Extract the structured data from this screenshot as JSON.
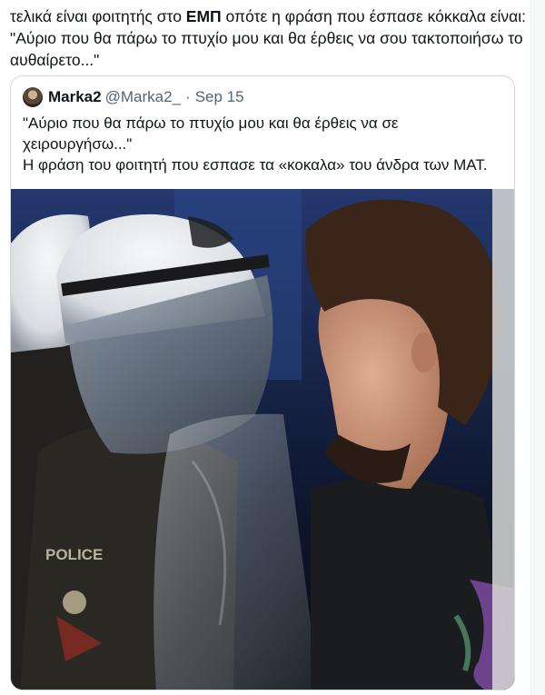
{
  "tweet": {
    "text_before": "τελικά είναι φοιτητής στο ",
    "text_bold": "ΕΜΠ",
    "text_after": " οπότε η φράση που έσπασε κόκκαλα είναι: \"Αύριο που θα πάρω το πτυχίο μου και θα έρθεις να σου τακτοποιήσω το αυθαίρετο...\""
  },
  "quoted": {
    "display_name": "Marka2",
    "handle": "@Marka2_",
    "separator": "·",
    "date": "Sep 15",
    "line1": "\"Αύριο που θα πάρω το πτυχίο μου και θα έρθεις να σε χειρουργήσω...\"",
    "line2": "Η φράση του φοιτητή που εσπασε τα «κοκαλα» του άνδρα των ΜΑΤ."
  },
  "photo": {
    "shield_text": "POLICE",
    "colors": {
      "background": "#1c2f5e",
      "helmet": "#e9ecef",
      "visor": "#6f7c8a",
      "skin": "#c99278",
      "hair": "#3a2518",
      "shirt": "#1b1c20",
      "dragon": "#7b4aa0"
    }
  },
  "icons": {
    "avatar": "user-avatar"
  }
}
